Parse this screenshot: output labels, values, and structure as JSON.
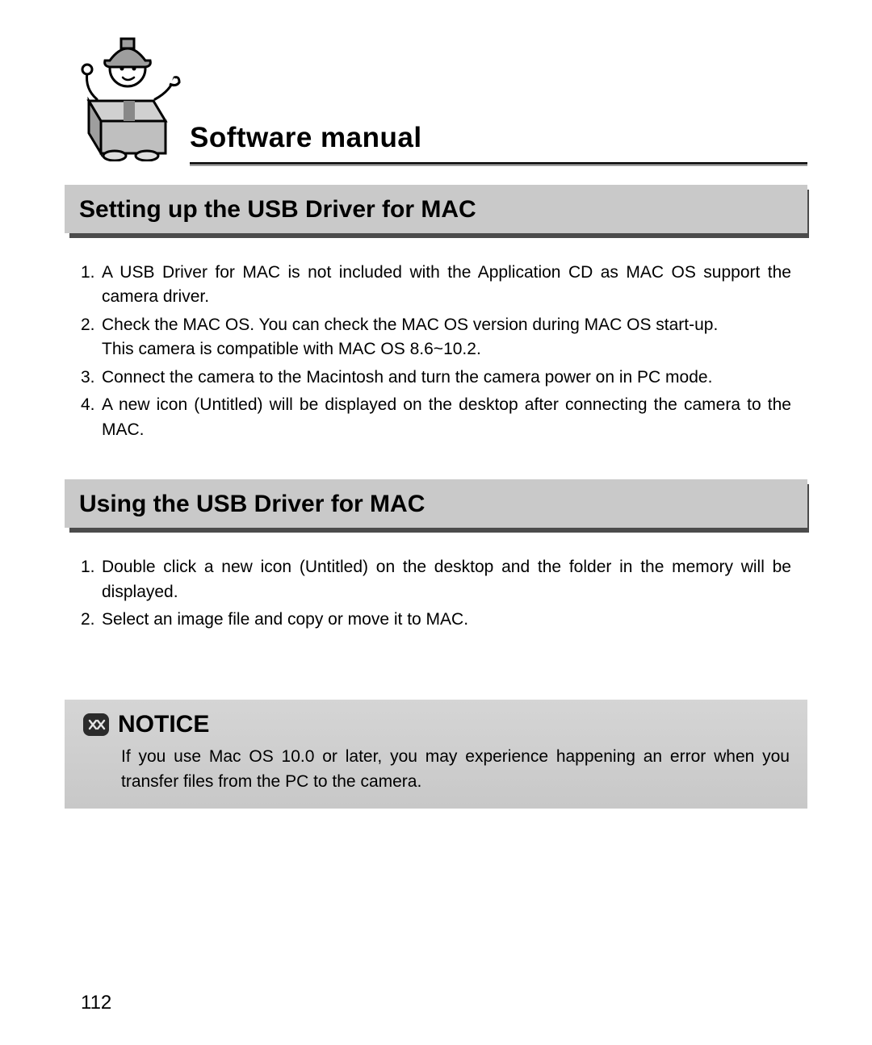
{
  "header": {
    "title": "Software manual"
  },
  "sections": [
    {
      "heading": "Setting up the USB Driver for MAC",
      "items": [
        {
          "n": "1.",
          "text": "A USB Driver for MAC is not included with the Application CD as MAC OS support the camera driver."
        },
        {
          "n": "2.",
          "text": "Check the MAC OS. You can check the MAC OS version during MAC OS start-up.",
          "sub": "This camera is compatible with MAC OS 8.6~10.2."
        },
        {
          "n": "3.",
          "text": "Connect the camera to the Macintosh and turn the camera power on in PC mode."
        },
        {
          "n": "4.",
          "text": "A new icon (Untitled) will be displayed on the desktop after connecting the camera to the MAC."
        }
      ]
    },
    {
      "heading": "Using the USB Driver for MAC",
      "items": [
        {
          "n": "1.",
          "text": "Double click a new icon (Untitled) on the desktop and the folder in the memory will be displayed."
        },
        {
          "n": "2.",
          "text": "Select an image file and copy or move it to MAC."
        }
      ]
    }
  ],
  "notice": {
    "label": "NOTICE",
    "body": "If you use Mac OS 10.0 or later, you may experience happening an error when you transfer files from the PC to the camera."
  },
  "page_number": "112"
}
